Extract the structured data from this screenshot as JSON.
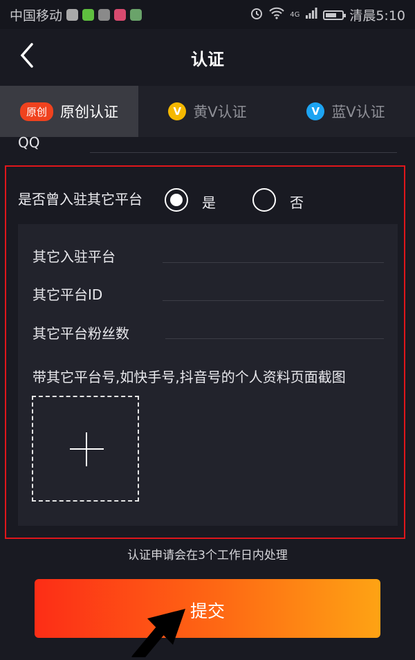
{
  "status_bar": {
    "carrier": "中国移动",
    "network": "4G",
    "time_label": "清晨5:10"
  },
  "navbar": {
    "title": "认证"
  },
  "tabs": [
    {
      "badge": "原创",
      "label": "原创认证",
      "active": true
    },
    {
      "badge": "V",
      "label": "黄V认证",
      "active": false,
      "badge_color": "#f5b800"
    },
    {
      "badge": "V",
      "label": "蓝V认证",
      "active": false,
      "badge_color": "#1da4f2"
    }
  ],
  "qq_field": {
    "label": "QQ"
  },
  "other_platform": {
    "question": "是否曾入驻其它平台",
    "options": [
      {
        "label": "是",
        "selected": true
      },
      {
        "label": "否",
        "selected": false
      }
    ],
    "fields": [
      {
        "label": "其它入驻平台"
      },
      {
        "label": "其它平台ID"
      },
      {
        "label": "其它平台粉丝数"
      }
    ],
    "upload_label": "带其它平台号,如快手号,抖音号的个人资料页面截图"
  },
  "notice": "认证申请会在3个工作日内处理",
  "submit_label": "提交",
  "colors": {
    "background": "#191a22",
    "accent_start": "#fd2d16",
    "accent_end": "#fea314",
    "highlight_border": "#e0161b"
  }
}
